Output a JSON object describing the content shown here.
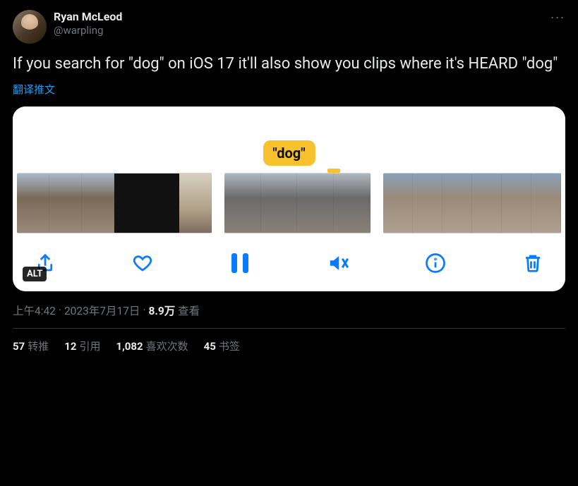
{
  "author": {
    "display_name": "Ryan McLeod",
    "handle": "@warpling"
  },
  "more_icon": "···",
  "content_text": "If you search for \"dog\" on iOS 17 it'll also show you clips where it's HEARD \"dog\"",
  "translate_label": "翻译推文",
  "media": {
    "highlight_label": "\"dog\"",
    "alt_badge": "ALT",
    "toolbar": {
      "share": "share-icon",
      "like": "heart-icon",
      "pause": "pause-icon",
      "mute": "mute-icon",
      "info": "info-icon",
      "trash": "trash-icon"
    }
  },
  "meta": {
    "time": "上午4:42",
    "dot1": "·",
    "date": "2023年7月17日",
    "dot2": "·",
    "views_count": "8.9万",
    "views_label": "查看"
  },
  "stats": {
    "retweets_count": "57",
    "retweets_label": "转推",
    "quotes_count": "12",
    "quotes_label": "引用",
    "likes_count": "1,082",
    "likes_label": "喜欢次数",
    "bookmarks_count": "45",
    "bookmarks_label": "书签"
  }
}
